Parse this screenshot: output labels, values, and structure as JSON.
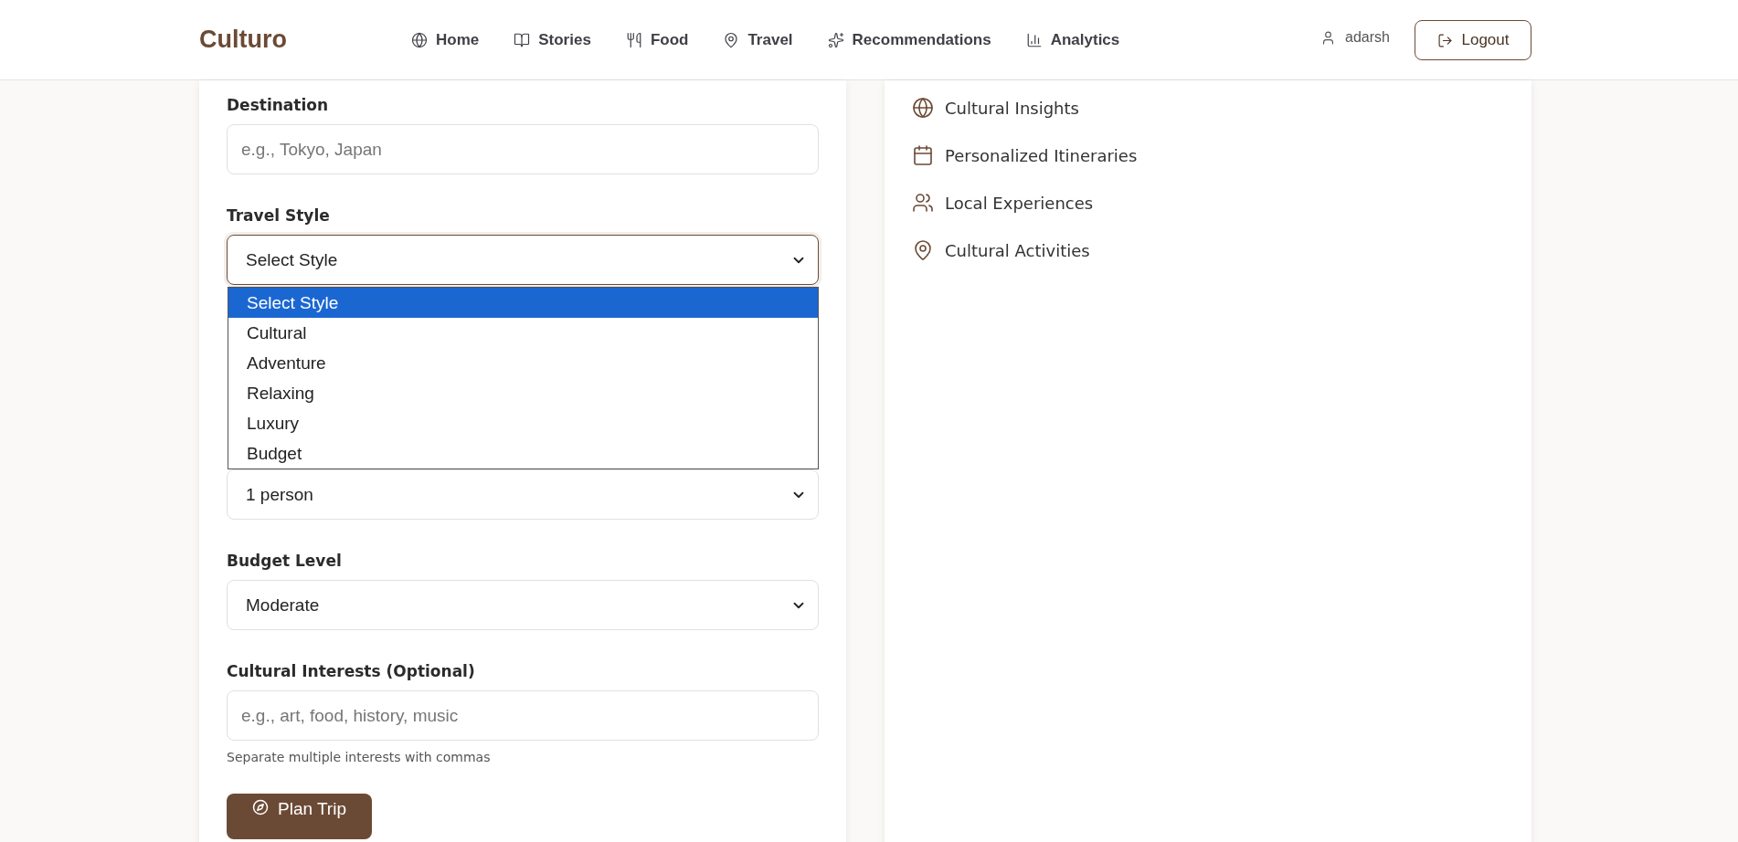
{
  "header": {
    "logo": "Culturo",
    "nav": [
      {
        "label": "Home"
      },
      {
        "label": "Stories"
      },
      {
        "label": "Food"
      },
      {
        "label": "Travel"
      },
      {
        "label": "Recommendations"
      },
      {
        "label": "Analytics"
      }
    ],
    "user": "adarsh",
    "logout": "Logout"
  },
  "form": {
    "fields": [
      {
        "kind": "input",
        "label": "Destination",
        "placeholder": "e.g., Tokyo, Japan"
      },
      {
        "kind": "select",
        "label": "Travel Style",
        "value": "Select Style",
        "expanded": true,
        "options": [
          {
            "label": "Select Style",
            "selected": true
          },
          {
            "label": "Cultural",
            "selected": false
          },
          {
            "label": "Adventure",
            "selected": false
          },
          {
            "label": "Relaxing",
            "selected": false
          },
          {
            "label": "Luxury",
            "selected": false
          },
          {
            "label": "Budget",
            "selected": false
          }
        ]
      },
      {
        "kind": "select",
        "value": "1 person",
        "expanded": false
      },
      {
        "kind": "select",
        "label": "Budget Level",
        "value": "Moderate",
        "expanded": false
      },
      {
        "kind": "input",
        "label": "Cultural Interests (Optional)",
        "placeholder": "e.g., art, food, history, music",
        "hint": "Separate multiple interests with commas"
      }
    ],
    "submit": "Plan Trip"
  },
  "features": [
    {
      "label": "Cultural Insights"
    },
    {
      "label": "Personalized Itineraries"
    },
    {
      "label": "Local Experiences"
    },
    {
      "label": "Cultural Activities"
    }
  ]
}
